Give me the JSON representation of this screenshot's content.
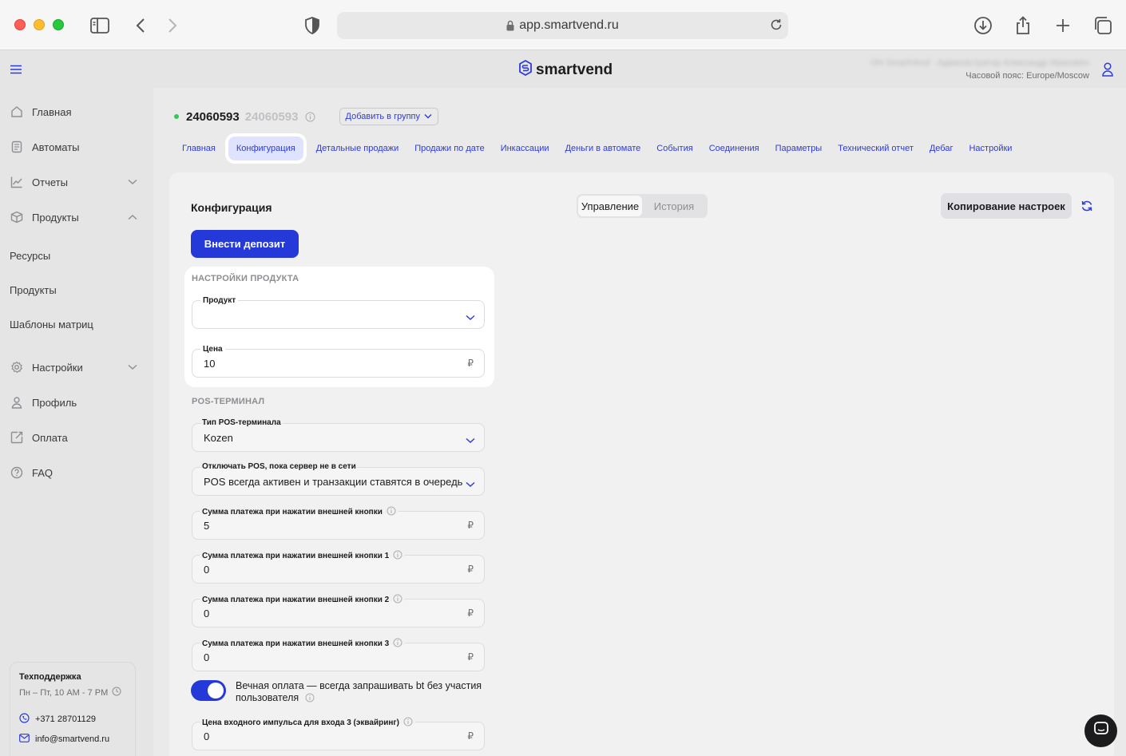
{
  "browser": {
    "url": "app.smartvend.ru"
  },
  "header": {
    "logo_text": "smartvend",
    "user_name": "ОН SmartVend · Администратор Александр Иванович",
    "timezone": "Часовой пояс: Europe/Moscow"
  },
  "sidebar": {
    "items": [
      {
        "label": "Главная",
        "icon": "home-icon"
      },
      {
        "label": "Автоматы",
        "icon": "machines-icon"
      },
      {
        "label": "Отчеты",
        "icon": "chart-icon"
      },
      {
        "label": "Продукты",
        "icon": "box-icon"
      },
      {
        "label": "Ресурсы"
      },
      {
        "label": "Продукты"
      },
      {
        "label": "Шаблоны матриц"
      },
      {
        "label": "Настройки",
        "icon": "gear-icon"
      },
      {
        "label": "Профиль",
        "icon": "user-icon"
      },
      {
        "label": "Оплата",
        "icon": "payment-icon"
      },
      {
        "label": "FAQ",
        "icon": "help-icon"
      }
    ],
    "support": {
      "title": "Техподдержка",
      "hours": "Пн – Пт, 10 AM - 7 PM",
      "phone": "+371 28701129",
      "email": "info@smartvend.ru"
    }
  },
  "device": {
    "id": "24060593",
    "id_secondary": "24060593",
    "group_button": "Добавить в группу",
    "status_color": "#34c759"
  },
  "tabs": [
    "Главная",
    "Конфигурация",
    "Детальные продажи",
    "Продажи по дате",
    "Инкассации",
    "Деньги в автомате",
    "События",
    "Соединения",
    "Параметры",
    "Технический отчет",
    "Дебаг",
    "Настройки"
  ],
  "active_tab": "Конфигурация",
  "config": {
    "title": "Конфигурация",
    "segments": [
      "Управление",
      "История"
    ],
    "active_segment": "Управление",
    "copy_button": "Копирование настроек",
    "deposit_button": "Внести депозит",
    "product_section": "НАСТРОЙКИ ПРОДУКТА",
    "product_label": "Продукт",
    "product_value": "",
    "price_label": "Цена",
    "price_value": "10",
    "currency": "₽",
    "pos_section": "POS-ТЕРМИНАЛ",
    "pos_type_label": "Тип POS-терминала",
    "pos_type_value": "Kozen",
    "pos_offline_label": "Отключать POS, пока сервер не в сети",
    "pos_offline_value": "POS всегда активен и транзакции ставятся в очередь",
    "btn0_label": "Сумма платежа при нажатии внешней кнопки",
    "btn0_value": "5",
    "btn1_label": "Сумма платежа при нажатии внешней кнопки 1",
    "btn1_value": "0",
    "btn2_label": "Сумма платежа при нажатии внешней кнопки 2",
    "btn2_value": "0",
    "btn3_label": "Сумма платежа при нажатии внешней кнопки 3",
    "btn3_value": "0",
    "toggle_label": "Вечная оплата — всегда запрашивать bt без участия пользователя",
    "toggle_on": true,
    "impulse_label": "Цена входного импульса для входа 3 (эквайринг)",
    "impulse_value": "0"
  },
  "colors": {
    "accent": "#2539d8",
    "link": "#2d3bd9"
  }
}
